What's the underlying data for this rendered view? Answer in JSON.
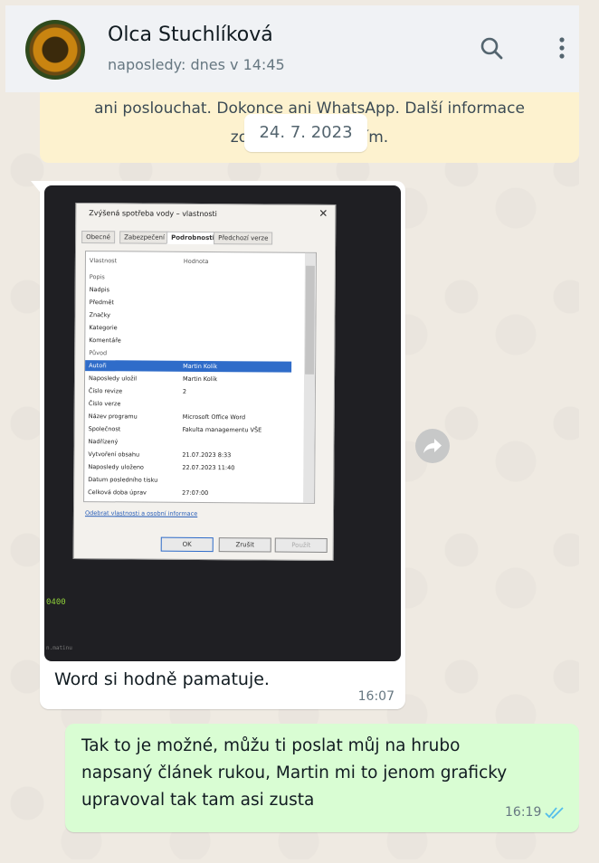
{
  "header": {
    "contact_name": "Olca Stuchlíková",
    "status": "naposledy: dnes v 14:45"
  },
  "banner": {
    "line1": "ani poslouchat. Dokonce ani WhatsApp. Další informace",
    "line2": "zobrazíte klepnutím."
  },
  "date_separator": "24. 7. 2023",
  "incoming_message": {
    "caption": "Word si hodně pamatuje.",
    "time": "16:07",
    "photo": {
      "window_title": "Zvýšená spotřeba vody – vlastnosti",
      "tabs": [
        "Obecné",
        "Zabezpečení",
        "Podrobnosti",
        "Předchozí verze"
      ],
      "columns": [
        "Vlastnost",
        "Hodnota"
      ],
      "rows": [
        {
          "k": "Popis",
          "v": ""
        },
        {
          "k": "Nadpis",
          "v": ""
        },
        {
          "k": "Předmět",
          "v": ""
        },
        {
          "k": "Značky",
          "v": ""
        },
        {
          "k": "Kategorie",
          "v": ""
        },
        {
          "k": "Komentáře",
          "v": ""
        },
        {
          "k": "Původ",
          "v": ""
        },
        {
          "k": "Autoři",
          "v": "Martin Kolík"
        },
        {
          "k": "Naposledy uložil",
          "v": "Martin Kolík"
        },
        {
          "k": "Číslo revize",
          "v": "2"
        },
        {
          "k": "Číslo verze",
          "v": ""
        },
        {
          "k": "Název programu",
          "v": "Microsoft Office Word"
        },
        {
          "k": "Společnost",
          "v": "Fakulta managementu VŠE"
        },
        {
          "k": "Nadřízený",
          "v": ""
        },
        {
          "k": "Vytvoření obsahu",
          "v": "21.07.2023 8:33"
        },
        {
          "k": "Naposledy uloženo",
          "v": "22.07.2023 11:40"
        },
        {
          "k": "Datum posledního tisku",
          "v": ""
        },
        {
          "k": "Celková doba úprav",
          "v": "27:07:00"
        }
      ],
      "link": "Odebrat vlastnosti a osobní informace",
      "buttons": [
        "OK",
        "Zrušit",
        "Použít"
      ],
      "green_text": "0400",
      "tiny_text": "n.matinu"
    }
  },
  "outgoing_message": {
    "lines": [
      "Tak to je možné, můžu ti poslat můj na hrubo",
      "napsaný článek rukou, Martin mi to jenom graficky",
      "upravoval tak tam asi zusta"
    ],
    "time": "16:19"
  },
  "colors": {
    "chat_bg": "#efeae2",
    "outgoing_bubble": "#d9fdd3",
    "banner_bg": "#fdf2cf",
    "read_ticks": "#53bdeb"
  },
  "icons": [
    "search-icon",
    "more-vertical-icon",
    "forward-icon",
    "double-check-icon"
  ]
}
